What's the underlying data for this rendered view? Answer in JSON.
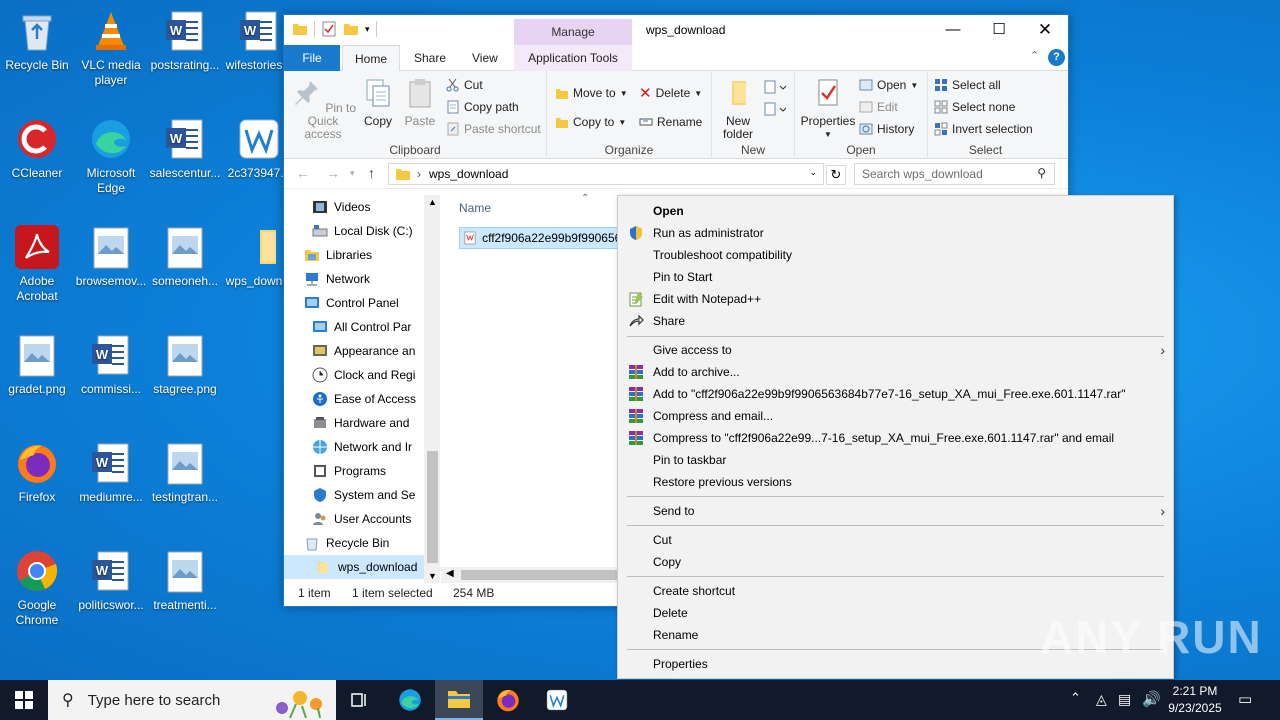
{
  "desktop": {
    "icons": [
      {
        "label": "Recycle Bin"
      },
      {
        "label": "VLC media player"
      },
      {
        "label": "postsrating..."
      },
      {
        "label": "wifestories..."
      },
      {
        "label": "CCleaner"
      },
      {
        "label": "Microsoft Edge"
      },
      {
        "label": "salescentur..."
      },
      {
        "label": "2c373947..."
      },
      {
        "label": "Adobe Acrobat"
      },
      {
        "label": "browsemov..."
      },
      {
        "label": "someoneh..."
      },
      {
        "label": "wps_down..."
      },
      {
        "label": "gradet.png"
      },
      {
        "label": "commissi..."
      },
      {
        "label": "stagree.png"
      },
      {
        "label": "Firefox"
      },
      {
        "label": "mediumre..."
      },
      {
        "label": "testingtran..."
      },
      {
        "label": "Google Chrome"
      },
      {
        "label": "politicswor..."
      },
      {
        "label": "treatmenti..."
      }
    ]
  },
  "explorer": {
    "title": "wps_download",
    "context_tab": "Manage",
    "tabs": {
      "file": "File",
      "home": "Home",
      "share": "Share",
      "view": "View",
      "app_tools": "Application Tools"
    },
    "clipboard": {
      "pin": "Pin to Quick access",
      "copy": "Copy",
      "paste": "Paste",
      "cut": "Cut",
      "copy_path": "Copy path",
      "paste_shortcut": "Paste shortcut",
      "label": "Clipboard"
    },
    "organize": {
      "move_to": "Move to",
      "copy_to": "Copy to",
      "delete": "Delete",
      "rename": "Rename",
      "label": "Organize"
    },
    "new": {
      "new_folder": "New folder",
      "label": "New"
    },
    "open": {
      "properties": "Properties",
      "open": "Open",
      "edit": "Edit",
      "history": "History",
      "label": "Open"
    },
    "select": {
      "select_all": "Select all",
      "select_none": "Select none",
      "invert": "Invert selection",
      "label": "Select"
    },
    "address": {
      "path": "wps_download",
      "search_placeholder": "Search wps_download"
    },
    "nav": [
      {
        "label": "Videos"
      },
      {
        "label": "Local Disk (C:)"
      },
      {
        "label": "Libraries"
      },
      {
        "label": "Network"
      },
      {
        "label": "Control Panel"
      },
      {
        "label": "All Control Par"
      },
      {
        "label": "Appearance an"
      },
      {
        "label": "Clock and Regi"
      },
      {
        "label": "Ease of Access"
      },
      {
        "label": "Hardware and"
      },
      {
        "label": "Network and Ir"
      },
      {
        "label": "Programs"
      },
      {
        "label": "System and Se"
      },
      {
        "label": "User Accounts"
      },
      {
        "label": "Recycle Bin"
      },
      {
        "label": "wps_download"
      }
    ],
    "column_name": "Name",
    "file_name": "cff2f906a22e99b9f9906563",
    "status": {
      "count": "1 item",
      "selected": "1 item selected",
      "size": "254 MB"
    }
  },
  "context_menu": {
    "items": [
      {
        "label": "Open"
      },
      {
        "label": "Run as administrator"
      },
      {
        "label": "Troubleshoot compatibility"
      },
      {
        "label": "Pin to Start"
      },
      {
        "label": "Edit with Notepad++"
      },
      {
        "label": "Share"
      },
      {
        "label": "Give access to"
      },
      {
        "label": "Add to archive..."
      },
      {
        "label": "Add to \"cff2f906a22e99b9f9906563684b77e7-16_setup_XA_mui_Free.exe.601.1147.rar\""
      },
      {
        "label": "Compress and email..."
      },
      {
        "label": "Compress to \"cff2f906a22e99...7-16_setup_XA_mui_Free.exe.601.1147.rar\" and email"
      },
      {
        "label": "Pin to taskbar"
      },
      {
        "label": "Restore previous versions"
      },
      {
        "label": "Send to"
      },
      {
        "label": "Cut"
      },
      {
        "label": "Copy"
      },
      {
        "label": "Create shortcut"
      },
      {
        "label": "Delete"
      },
      {
        "label": "Rename"
      },
      {
        "label": "Properties"
      }
    ]
  },
  "taskbar": {
    "search_placeholder": "Type here to search",
    "time": "2:21 PM",
    "date": "9/23/2025"
  },
  "watermark": "ANY RUN"
}
